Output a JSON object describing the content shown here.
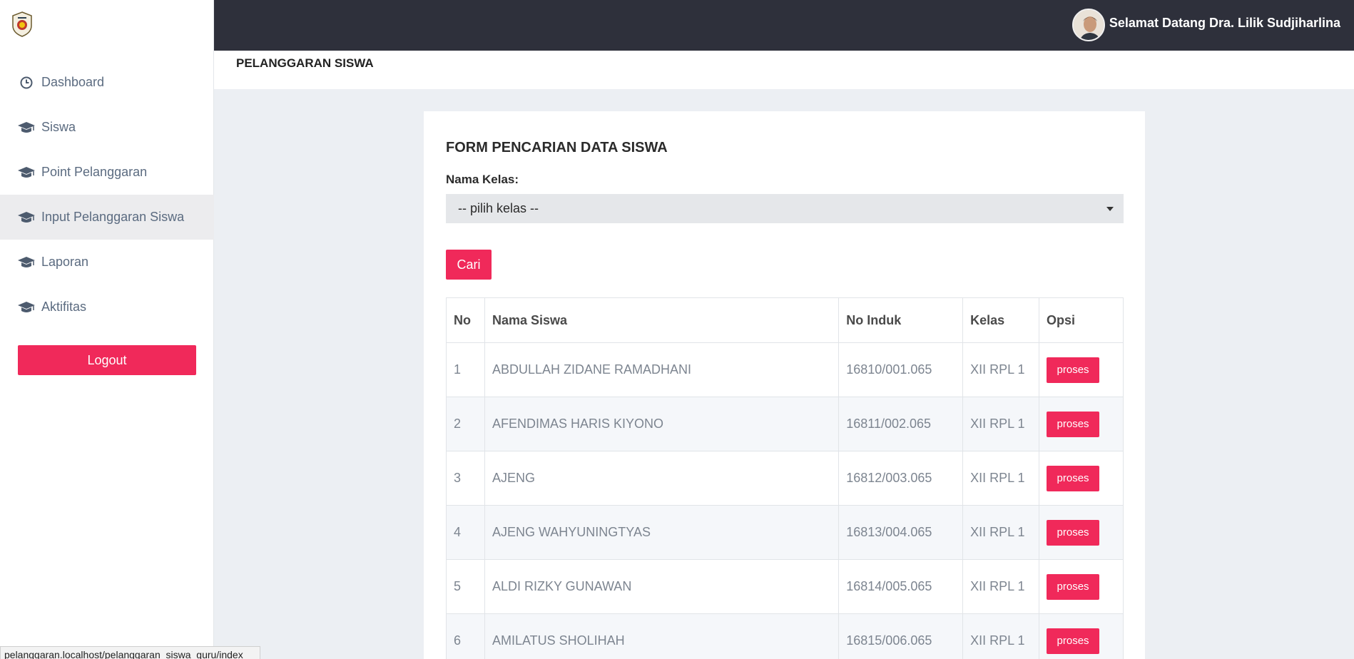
{
  "header": {
    "welcome": "Selamat Datang Dra. Lilik Sudjiharlina"
  },
  "sidebar": {
    "items": [
      {
        "label": "Dashboard",
        "icon": "clock-icon"
      },
      {
        "label": "Siswa",
        "icon": "graduation-cap-icon"
      },
      {
        "label": "Point Pelanggaran",
        "icon": "graduation-cap-icon"
      },
      {
        "label": "Input Pelanggaran Siswa",
        "icon": "graduation-cap-icon",
        "active": true
      },
      {
        "label": "Laporan",
        "icon": "graduation-cap-icon"
      },
      {
        "label": "Aktifitas",
        "icon": "graduation-cap-icon"
      }
    ],
    "logout_label": "Logout"
  },
  "page": {
    "title": "PELANGGARAN SISWA"
  },
  "form": {
    "title": "FORM PENCARIAN DATA SISWA",
    "kelas_label": "Nama Kelas:",
    "kelas_selected": "-- pilih kelas --",
    "search_label": "Cari"
  },
  "table": {
    "headers": [
      "No",
      "Nama Siswa",
      "No Induk",
      "Kelas",
      "Opsi"
    ],
    "action_label": "proses",
    "rows": [
      {
        "no": "1",
        "nama": "ABDULLAH ZIDANE RAMADHANI",
        "induk": "16810/001.065",
        "kelas": "XII RPL 1"
      },
      {
        "no": "2",
        "nama": "AFENDIMAS HARIS KIYONO",
        "induk": "16811/002.065",
        "kelas": "XII RPL 1"
      },
      {
        "no": "3",
        "nama": "AJENG",
        "induk": "16812/003.065",
        "kelas": "XII RPL 1"
      },
      {
        "no": "4",
        "nama": "AJENG WAHYUNINGTYAS",
        "induk": "16813/004.065",
        "kelas": "XII RPL 1"
      },
      {
        "no": "5",
        "nama": "ALDI RIZKY GUNAWAN",
        "induk": "16814/005.065",
        "kelas": "XII RPL 1"
      },
      {
        "no": "6",
        "nama": "AMILATUS SHOLIHAH",
        "induk": "16815/006.065",
        "kelas": "XII RPL 1"
      }
    ]
  },
  "status_bar": {
    "url": "pelanggaran.localhost/pelanggaran_siswa_guru/index"
  },
  "colors": {
    "accent": "#f0295a",
    "topbar": "#2e303b",
    "background": "#eceff3"
  }
}
